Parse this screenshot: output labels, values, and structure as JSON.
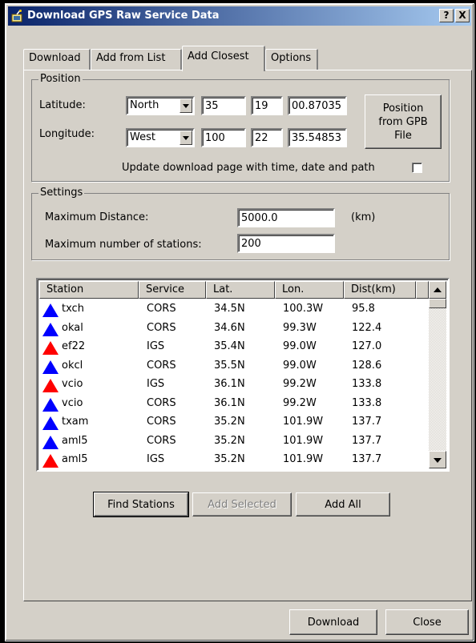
{
  "window": {
    "title": "Download GPS Raw Service Data",
    "help_label": "?",
    "close_label": "X"
  },
  "tabs": [
    {
      "label": "Download"
    },
    {
      "label": "Add from List"
    },
    {
      "label": "Add Closest"
    },
    {
      "label": "Options"
    }
  ],
  "position": {
    "legend": "Position",
    "latitude": {
      "label": "Latitude:",
      "hemisphere": "North",
      "deg": "35",
      "min": "19",
      "sec": "00.87035"
    },
    "longitude": {
      "label": "Longitude:",
      "hemisphere": "West",
      "deg": "100",
      "min": "22",
      "sec": "35.54853"
    },
    "from_file_button": "Position from GPB File",
    "update_label": "Update download page with time, date and path"
  },
  "settings": {
    "legend": "Settings",
    "max_distance_label": "Maximum Distance:",
    "max_distance_value": "5000.0",
    "unit": "(km)",
    "max_stations_label": "Maximum number of stations:",
    "max_stations_value": "200"
  },
  "list": {
    "columns": [
      "Station",
      "Service",
      "Lat.",
      "Lon.",
      "Dist(km)"
    ],
    "rows": [
      {
        "station": "txch",
        "service": "CORS",
        "lat": "34.5N",
        "lon": "100.3W",
        "dist": "95.8",
        "color": "#0000ff"
      },
      {
        "station": "okal",
        "service": "CORS",
        "lat": "34.6N",
        "lon": "99.3W",
        "dist": "122.4",
        "color": "#0000ff"
      },
      {
        "station": "ef22",
        "service": "IGS",
        "lat": "35.4N",
        "lon": "99.0W",
        "dist": "127.0",
        "color": "#ff0000"
      },
      {
        "station": "okcl",
        "service": "CORS",
        "lat": "35.5N",
        "lon": "99.0W",
        "dist": "128.6",
        "color": "#0000ff"
      },
      {
        "station": "vcio",
        "service": "IGS",
        "lat": "36.1N",
        "lon": "99.2W",
        "dist": "133.8",
        "color": "#ff0000"
      },
      {
        "station": "vcio",
        "service": "CORS",
        "lat": "36.1N",
        "lon": "99.2W",
        "dist": "133.8",
        "color": "#0000ff"
      },
      {
        "station": "txam",
        "service": "CORS",
        "lat": "35.2N",
        "lon": "101.9W",
        "dist": "137.7",
        "color": "#0000ff"
      },
      {
        "station": "aml5",
        "service": "CORS",
        "lat": "35.2N",
        "lon": "101.9W",
        "dist": "137.7",
        "color": "#0000ff"
      },
      {
        "station": "aml5",
        "service": "IGS",
        "lat": "35.2N",
        "lon": "101.9W",
        "dist": "137.7",
        "color": "#ff0000"
      }
    ]
  },
  "actions": {
    "find": "Find Stations",
    "add_selected": "Add Selected",
    "add_all": "Add All"
  },
  "footer": {
    "download": "Download",
    "close": "Close"
  },
  "colors": {
    "titlebar_start": "#0a246a",
    "titlebar_end": "#a6caf0",
    "face": "#d4d0c8",
    "cors_marker": "#0000ff",
    "igs_marker": "#ff0000"
  }
}
